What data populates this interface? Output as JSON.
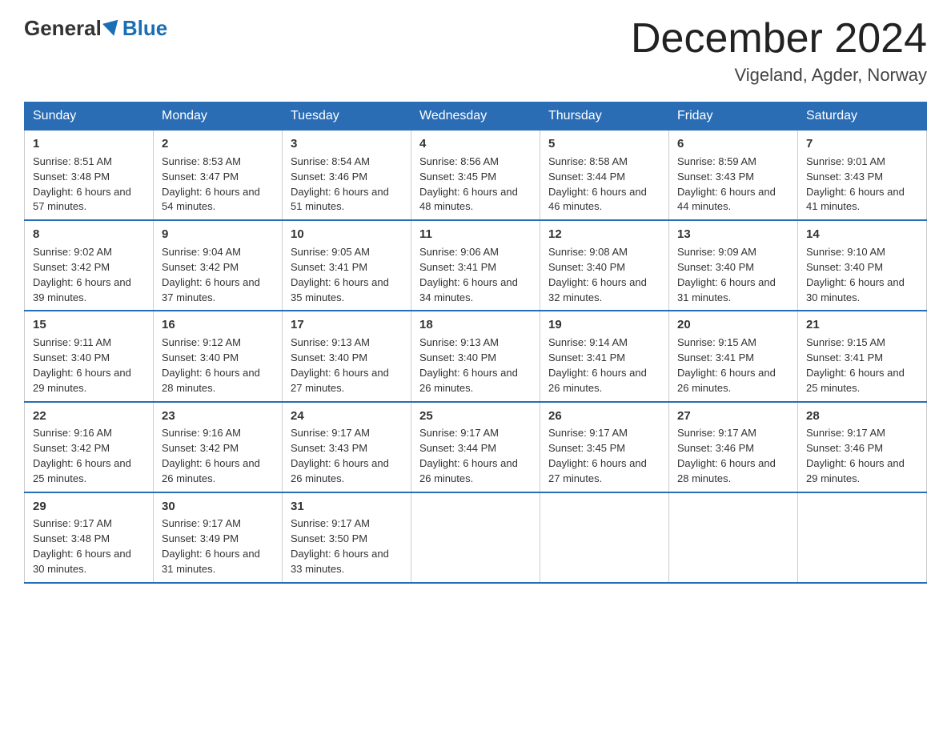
{
  "header": {
    "logo_general": "General",
    "logo_blue": "Blue",
    "month_title": "December 2024",
    "location": "Vigeland, Agder, Norway"
  },
  "days_of_week": [
    "Sunday",
    "Monday",
    "Tuesday",
    "Wednesday",
    "Thursday",
    "Friday",
    "Saturday"
  ],
  "weeks": [
    [
      {
        "day": "1",
        "sunrise": "8:51 AM",
        "sunset": "3:48 PM",
        "daylight": "6 hours and 57 minutes."
      },
      {
        "day": "2",
        "sunrise": "8:53 AM",
        "sunset": "3:47 PM",
        "daylight": "6 hours and 54 minutes."
      },
      {
        "day": "3",
        "sunrise": "8:54 AM",
        "sunset": "3:46 PM",
        "daylight": "6 hours and 51 minutes."
      },
      {
        "day": "4",
        "sunrise": "8:56 AM",
        "sunset": "3:45 PM",
        "daylight": "6 hours and 48 minutes."
      },
      {
        "day": "5",
        "sunrise": "8:58 AM",
        "sunset": "3:44 PM",
        "daylight": "6 hours and 46 minutes."
      },
      {
        "day": "6",
        "sunrise": "8:59 AM",
        "sunset": "3:43 PM",
        "daylight": "6 hours and 44 minutes."
      },
      {
        "day": "7",
        "sunrise": "9:01 AM",
        "sunset": "3:43 PM",
        "daylight": "6 hours and 41 minutes."
      }
    ],
    [
      {
        "day": "8",
        "sunrise": "9:02 AM",
        "sunset": "3:42 PM",
        "daylight": "6 hours and 39 minutes."
      },
      {
        "day": "9",
        "sunrise": "9:04 AM",
        "sunset": "3:42 PM",
        "daylight": "6 hours and 37 minutes."
      },
      {
        "day": "10",
        "sunrise": "9:05 AM",
        "sunset": "3:41 PM",
        "daylight": "6 hours and 35 minutes."
      },
      {
        "day": "11",
        "sunrise": "9:06 AM",
        "sunset": "3:41 PM",
        "daylight": "6 hours and 34 minutes."
      },
      {
        "day": "12",
        "sunrise": "9:08 AM",
        "sunset": "3:40 PM",
        "daylight": "6 hours and 32 minutes."
      },
      {
        "day": "13",
        "sunrise": "9:09 AM",
        "sunset": "3:40 PM",
        "daylight": "6 hours and 31 minutes."
      },
      {
        "day": "14",
        "sunrise": "9:10 AM",
        "sunset": "3:40 PM",
        "daylight": "6 hours and 30 minutes."
      }
    ],
    [
      {
        "day": "15",
        "sunrise": "9:11 AM",
        "sunset": "3:40 PM",
        "daylight": "6 hours and 29 minutes."
      },
      {
        "day": "16",
        "sunrise": "9:12 AM",
        "sunset": "3:40 PM",
        "daylight": "6 hours and 28 minutes."
      },
      {
        "day": "17",
        "sunrise": "9:13 AM",
        "sunset": "3:40 PM",
        "daylight": "6 hours and 27 minutes."
      },
      {
        "day": "18",
        "sunrise": "9:13 AM",
        "sunset": "3:40 PM",
        "daylight": "6 hours and 26 minutes."
      },
      {
        "day": "19",
        "sunrise": "9:14 AM",
        "sunset": "3:41 PM",
        "daylight": "6 hours and 26 minutes."
      },
      {
        "day": "20",
        "sunrise": "9:15 AM",
        "sunset": "3:41 PM",
        "daylight": "6 hours and 26 minutes."
      },
      {
        "day": "21",
        "sunrise": "9:15 AM",
        "sunset": "3:41 PM",
        "daylight": "6 hours and 25 minutes."
      }
    ],
    [
      {
        "day": "22",
        "sunrise": "9:16 AM",
        "sunset": "3:42 PM",
        "daylight": "6 hours and 25 minutes."
      },
      {
        "day": "23",
        "sunrise": "9:16 AM",
        "sunset": "3:42 PM",
        "daylight": "6 hours and 26 minutes."
      },
      {
        "day": "24",
        "sunrise": "9:17 AM",
        "sunset": "3:43 PM",
        "daylight": "6 hours and 26 minutes."
      },
      {
        "day": "25",
        "sunrise": "9:17 AM",
        "sunset": "3:44 PM",
        "daylight": "6 hours and 26 minutes."
      },
      {
        "day": "26",
        "sunrise": "9:17 AM",
        "sunset": "3:45 PM",
        "daylight": "6 hours and 27 minutes."
      },
      {
        "day": "27",
        "sunrise": "9:17 AM",
        "sunset": "3:46 PM",
        "daylight": "6 hours and 28 minutes."
      },
      {
        "day": "28",
        "sunrise": "9:17 AM",
        "sunset": "3:46 PM",
        "daylight": "6 hours and 29 minutes."
      }
    ],
    [
      {
        "day": "29",
        "sunrise": "9:17 AM",
        "sunset": "3:48 PM",
        "daylight": "6 hours and 30 minutes."
      },
      {
        "day": "30",
        "sunrise": "9:17 AM",
        "sunset": "3:49 PM",
        "daylight": "6 hours and 31 minutes."
      },
      {
        "day": "31",
        "sunrise": "9:17 AM",
        "sunset": "3:50 PM",
        "daylight": "6 hours and 33 minutes."
      },
      null,
      null,
      null,
      null
    ]
  ]
}
